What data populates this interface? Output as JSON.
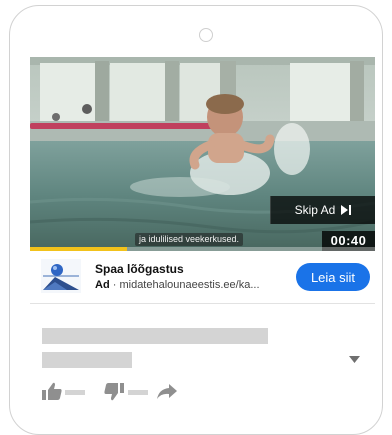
{
  "video": {
    "caption_text": "ja idulilised veekerkused.",
    "skip_label": "Skip Ad",
    "time_remaining": "00:40",
    "progress": 0.28,
    "progress_color": "#f2c21b"
  },
  "ad": {
    "title": "Spaa lõõgastus",
    "badge": "Ad",
    "separator": "·",
    "url": "midatehalounaeestis.ee/ka...",
    "cta_label": "Leia siit",
    "cta_color": "#1a73e8"
  },
  "icons": {
    "skip": "skip-next-icon",
    "logo": "advertiser-logo-icon",
    "expand": "chevron-down-icon",
    "like": "thumbs-up-icon",
    "dislike": "thumbs-down-icon",
    "share": "share-arrow-icon"
  }
}
